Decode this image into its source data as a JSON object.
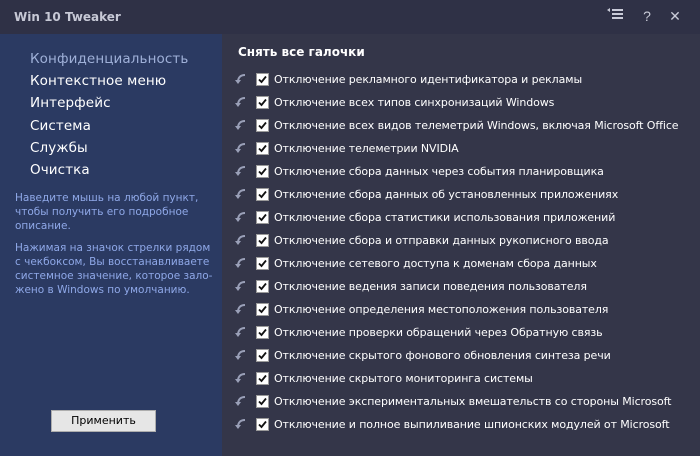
{
  "window": {
    "title": "Win 10 Tweaker",
    "buttons": [
      "menu-icon",
      "help-icon",
      "close-icon"
    ],
    "help_glyph": "?",
    "close_glyph": "✕"
  },
  "sidebar": {
    "items": [
      {
        "label": "Конфиденциальность",
        "active": true
      },
      {
        "label": "Контекстное меню"
      },
      {
        "label": "Интерфейс"
      },
      {
        "label": "Система"
      },
      {
        "label": "Службы"
      },
      {
        "label": "Очистка"
      }
    ],
    "hint1": "Наведите мышь на любой пункт, чтобы получить его подробное описание.",
    "hint2": "Нажимая на значок стрелки рядом с чекбоксом, Вы восстанавливаете системное значение, которое зало- жено в Windows по умолчанию.",
    "apply_label": "Применить"
  },
  "main": {
    "header": "Снять все галочки",
    "items": [
      {
        "label": "Отключение рекламного идентификатора и рекламы",
        "checked": true
      },
      {
        "label": "Отключение всех типов синхронизаций Windows",
        "checked": true
      },
      {
        "label": "Отключение всех видов телеметрий Windows, включая Microsoft Office",
        "checked": true
      },
      {
        "label": "Отключение телеметрии NVIDIA",
        "checked": true
      },
      {
        "label": "Отключение сбора данных через события планировщика",
        "checked": true
      },
      {
        "label": "Отключение сбора данных об установленных приложениях",
        "checked": true
      },
      {
        "label": "Отключение сбора статистики использования приложений",
        "checked": true
      },
      {
        "label": "Отключение сбора и отправки данных рукописного ввода",
        "checked": true
      },
      {
        "label": "Отключение сетевого доступа к доменам сбора данных",
        "checked": true
      },
      {
        "label": "Отключение ведения записи поведения пользователя",
        "checked": true
      },
      {
        "label": "Отключение определения местоположения пользователя",
        "checked": true
      },
      {
        "label": "Отключение проверки обращений через Обратную связь",
        "checked": true
      },
      {
        "label": "Отключение скрытого фонового обновления синтеза речи",
        "checked": true
      },
      {
        "label": "Отключение скрытого мониторинга системы",
        "checked": true
      },
      {
        "label": "Отключение экспериментальных вмешательств со стороны Microsoft",
        "checked": true
      },
      {
        "label": "Отключение и полное выпиливание шпионских модулей от Microsoft",
        "checked": true
      }
    ]
  },
  "colors": {
    "background": "#2f3146",
    "sidebar": "#2b3a62",
    "hint_text": "#8fa8e8",
    "active_item": "#9fb0d8"
  }
}
